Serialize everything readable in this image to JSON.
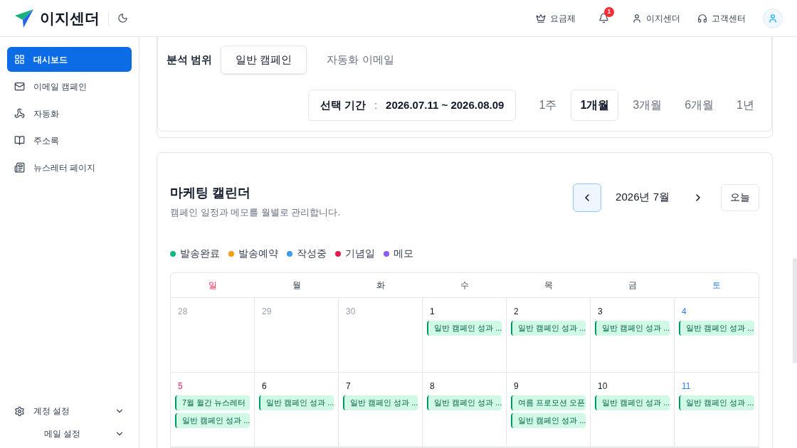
{
  "header": {
    "logo": "이지센더",
    "nav": [
      {
        "kind": "plan",
        "label": "요금제"
      },
      {
        "kind": "bell",
        "badge": "1"
      },
      {
        "kind": "user",
        "label": "이지센더"
      },
      {
        "kind": "support",
        "label": "고객센터"
      }
    ]
  },
  "sidebar": {
    "items": [
      {
        "label": "대시보드",
        "selected": true
      },
      {
        "label": "이메일 캠페인",
        "selected": false
      },
      {
        "label": "자동화",
        "selected": false
      },
      {
        "label": "주소록",
        "selected": false
      },
      {
        "label": "뉴스레터 페이지",
        "selected": false
      }
    ],
    "bottom": [
      {
        "label": "계정 설정",
        "expanded": false
      },
      {
        "label": "메일 설정",
        "expanded": false
      }
    ]
  },
  "analysis": {
    "label": "분석 범위",
    "scopes": [
      {
        "label": "일반 캠페인",
        "selected": true
      },
      {
        "label": "자동화 이메일",
        "selected": false
      }
    ],
    "period_label": "선택 기간",
    "period_sep": ":",
    "period": "2026.07.11 ~ 2026.08.09",
    "ranges": [
      {
        "label": "1주",
        "selected": false
      },
      {
        "label": "1개월",
        "selected": true
      },
      {
        "label": "3개월",
        "selected": false
      },
      {
        "label": "6개월",
        "selected": false
      },
      {
        "label": "1년",
        "selected": false
      }
    ]
  },
  "calendar": {
    "title": "마케팅 캘린더",
    "subtitle": "캠페인 일정과 메모를 월별로 관리합니다.",
    "month": "2026년 7월",
    "today": "오늘",
    "legend": [
      {
        "label": "발송완료",
        "color": "#10b981"
      },
      {
        "label": "발송예약",
        "color": "#f59e0b"
      },
      {
        "label": "작성중",
        "color": "#3b9ee8"
      },
      {
        "label": "기념일",
        "color": "#e11d48"
      },
      {
        "label": "메모",
        "color": "#8b5cf6"
      }
    ],
    "weekdays": [
      {
        "label": "일",
        "kind": "sun"
      },
      {
        "label": "월",
        "kind": "day"
      },
      {
        "label": "화",
        "kind": "day"
      },
      {
        "label": "수",
        "kind": "day"
      },
      {
        "label": "목",
        "kind": "day"
      },
      {
        "label": "금",
        "kind": "day"
      },
      {
        "label": "토",
        "kind": "sat"
      }
    ],
    "weeks": [
      [
        {
          "day": "28",
          "kind": "other"
        },
        {
          "day": "29",
          "kind": "other"
        },
        {
          "day": "30",
          "kind": "other"
        },
        {
          "day": "1",
          "kind": "day",
          "events": [
            "일반 캠페인 성과 ..."
          ]
        },
        {
          "day": "2",
          "kind": "day",
          "events": [
            "일반 캠페인 성과 ..."
          ]
        },
        {
          "day": "3",
          "kind": "day",
          "events": [
            "일반 캠페인 성과 ..."
          ]
        },
        {
          "day": "4",
          "kind": "sat",
          "events": [
            "일반 캠페인 성과 ..."
          ]
        }
      ],
      [
        {
          "day": "5",
          "kind": "sun",
          "events": [
            "7월 월간 뉴스레터",
            "일반 캠페인 성과 ..."
          ]
        },
        {
          "day": "6",
          "kind": "day",
          "events": [
            "일반 캠페인 성과 ..."
          ]
        },
        {
          "day": "7",
          "kind": "day",
          "events": [
            "일반 캠페인 성과 ..."
          ]
        },
        {
          "day": "8",
          "kind": "day",
          "events": [
            "일반 캠페인 성과 ..."
          ]
        },
        {
          "day": "9",
          "kind": "day",
          "events": [
            "여름 프로모션 오픈",
            "일반 캠페인 성과 ..."
          ]
        },
        {
          "day": "10",
          "kind": "day",
          "events": [
            "일반 캠페인 성과 ..."
          ]
        },
        {
          "day": "11",
          "kind": "sat",
          "events": [
            "일반 캠페인 성과 ..."
          ]
        }
      ]
    ]
  }
}
